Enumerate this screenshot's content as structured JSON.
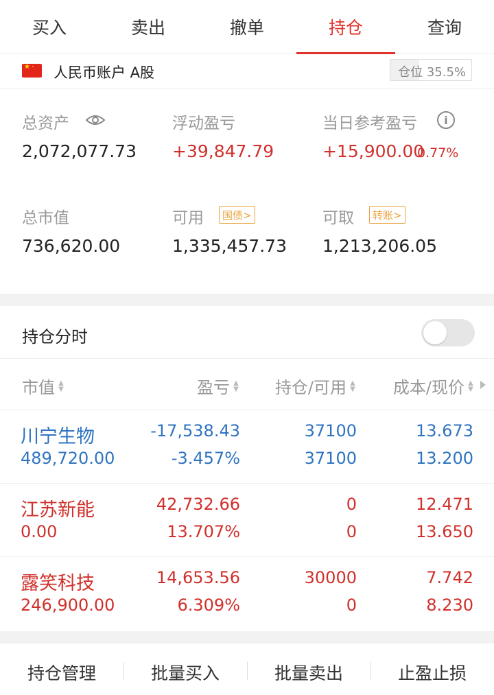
{
  "tabs": [
    {
      "label": "买入"
    },
    {
      "label": "卖出"
    },
    {
      "label": "撤单"
    },
    {
      "label": "持仓",
      "active": true
    },
    {
      "label": "查询"
    }
  ],
  "account": {
    "name": "人民币账户 A股",
    "position_label": "仓位 35.5%",
    "position_ratio": 0.355
  },
  "summary": {
    "total_assets_label": "总资产",
    "total_assets": "2,072,077.73",
    "floating_pnl_label": "浮动盈亏",
    "floating_pnl": "+39,847.79",
    "daily_pnl_label": "当日参考盈亏",
    "daily_pnl": "+15,900.00",
    "daily_pnl_pct": "0.77%",
    "market_value_label": "总市值",
    "market_value": "736,620.00",
    "available_label": "可用",
    "available_btn": "国债>",
    "available": "1,335,457.73",
    "withdrawable_label": "可取",
    "withdrawable_btn": "转账>",
    "withdrawable": "1,213,206.05"
  },
  "section": {
    "title": "持仓分时",
    "toggle_on": false
  },
  "table": {
    "headers": [
      "市值",
      "盈亏",
      "持仓/可用",
      "成本/现价"
    ],
    "rows": [
      {
        "name": "川宁生物",
        "market_value": "489,720.00",
        "pnl": "-17,538.43",
        "pnl_pct": "-3.457%",
        "position": "37100",
        "available": "37100",
        "cost": "13.673",
        "price": "13.200",
        "color": "blue"
      },
      {
        "name": "江苏新能",
        "market_value": "0.00",
        "pnl": "42,732.66",
        "pnl_pct": "13.707%",
        "position": "0",
        "available": "0",
        "cost": "12.471",
        "price": "13.650",
        "color": "red"
      },
      {
        "name": "露笑科技",
        "market_value": "246,900.00",
        "pnl": "14,653.56",
        "pnl_pct": "6.309%",
        "position": "30000",
        "available": "0",
        "cost": "7.742",
        "price": "8.230",
        "color": "red"
      }
    ]
  },
  "bottom": [
    "持仓管理",
    "批量买入",
    "批量卖出",
    "止盈止损"
  ],
  "colors": {
    "accent": "#e0312a",
    "loss": "#2f74c0",
    "gain": "#d0302b"
  }
}
